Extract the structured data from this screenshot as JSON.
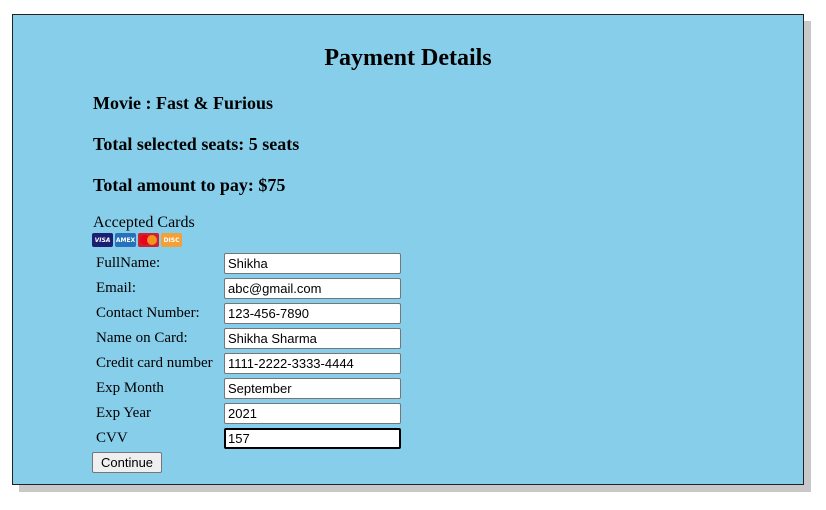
{
  "title": "Payment Details",
  "movie": "Movie : Fast & Furious",
  "seats": "Total selected seats: 5 seats",
  "amount": "Total amount to pay: $75",
  "accepted_cards": {
    "label": "Accepted Cards",
    "cards": [
      {
        "name": "visa-icon",
        "text": "VISA"
      },
      {
        "name": "amex-icon",
        "text": "AMEX"
      },
      {
        "name": "mastercard-icon",
        "text": ""
      },
      {
        "name": "discover-icon",
        "text": "DISC"
      }
    ]
  },
  "form": {
    "fields": [
      {
        "label": "FullName:",
        "value": "Shikha"
      },
      {
        "label": "Email:",
        "value": "abc@gmail.com"
      },
      {
        "label": "Contact Number:",
        "value": "123-456-7890"
      },
      {
        "label": "Name on Card:",
        "value": "Shikha Sharma"
      },
      {
        "label": "Credit card number",
        "value": "1111-2222-3333-4444"
      },
      {
        "label": "Exp Month",
        "value": "September"
      },
      {
        "label": "Exp Year",
        "value": "2021"
      },
      {
        "label": "CVV",
        "value": "157"
      }
    ],
    "continue_label": "Continue"
  },
  "colors": {
    "panel_bg": "#87ceeb",
    "border": "#222222"
  }
}
